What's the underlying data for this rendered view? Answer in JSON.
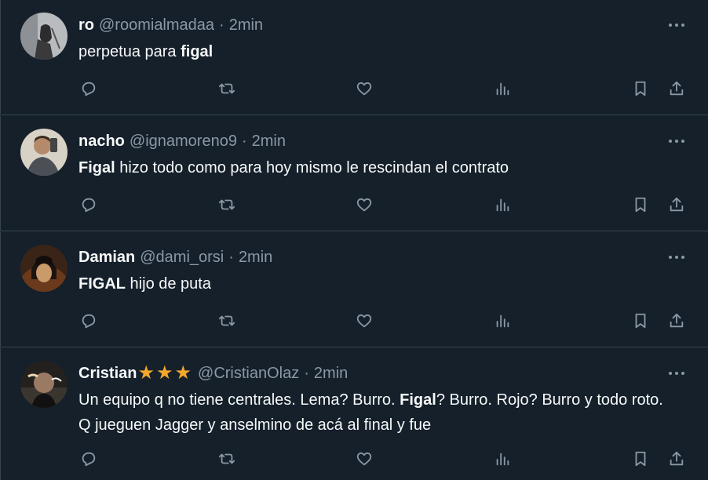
{
  "tweets": [
    {
      "name": "ro",
      "stars": "",
      "handle": "@roomialmadaa",
      "dot": "·",
      "time": "2min",
      "text_a": "perpetua para ",
      "bold_a": "figal",
      "text_b": "",
      "bold_b": "",
      "text_c": ""
    },
    {
      "name": "nacho",
      "stars": "",
      "handle": "@ignamoreno9",
      "dot": "·",
      "time": "2min",
      "text_a": "",
      "bold_a": "Figal",
      "text_b": " hizo todo como para hoy mismo le rescindan el contrato",
      "bold_b": "",
      "text_c": ""
    },
    {
      "name": "Damian",
      "stars": "",
      "handle": "@dami_orsi",
      "dot": "·",
      "time": "2min",
      "text_a": "",
      "bold_a": "FIGAL",
      "text_b": " hijo de puta",
      "bold_b": "",
      "text_c": ""
    },
    {
      "name": "Cristian",
      "stars": "★★★",
      "handle": "@CristianOlaz",
      "dot": "·",
      "time": "2min",
      "text_a": "Un equipo q no tiene centrales. Lema? Burro. ",
      "bold_a": "Figal",
      "text_b": "? Burro. Rojo? Burro y todo roto. Q jueguen Jagger y anselmino de acá al final y fue",
      "bold_b": "",
      "text_c": ""
    }
  ],
  "icons": {
    "more": "more-horizontal-icon",
    "reply": "reply-icon",
    "retweet": "retweet-icon",
    "like": "heart-icon",
    "views": "views-chart-icon",
    "bookmark": "bookmark-icon",
    "share": "share-icon"
  },
  "colors": {
    "background": "#15202b",
    "text": "#f7f9f9",
    "muted": "#8b98a5",
    "divider": "#38444d",
    "star": "#f4a72a"
  }
}
